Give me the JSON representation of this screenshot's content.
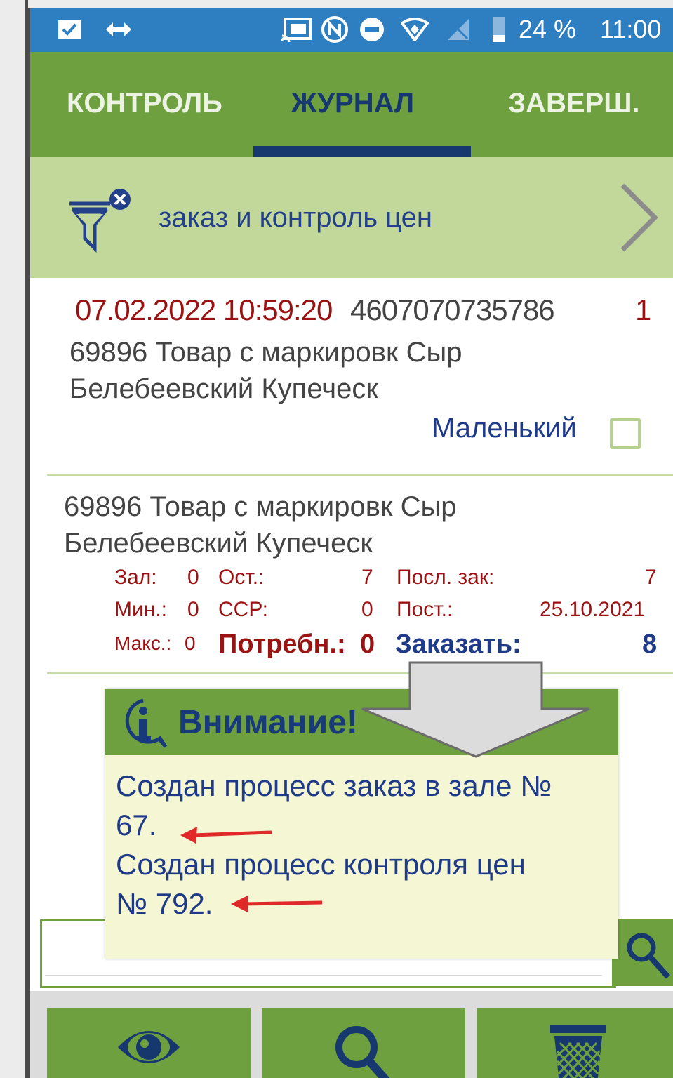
{
  "statusbar": {
    "battery": "24 %",
    "time": "11:00",
    "icons": [
      "checkbox-notification-icon",
      "code-icon",
      "cast-icon",
      "nfc-icon",
      "do-not-disturb-icon",
      "vpn-icon",
      "signal-off-icon",
      "battery-icon"
    ]
  },
  "tabs": [
    {
      "label": "КОНТРОЛЬ",
      "active": false
    },
    {
      "label": "ЖУРНАЛ",
      "active": true
    },
    {
      "label": "ЗАВЕРШ.",
      "active": false
    }
  ],
  "filter": {
    "label": "заказ и контроль цен",
    "icons": [
      "filter-clear-icon",
      "chevron-right-icon"
    ]
  },
  "item1": {
    "datetime": "07.02.2022 10:59:20",
    "barcode": "4607070735786",
    "count": "1",
    "title_line1": "69896   Товар с маркировк Сыр",
    "title_line2": "Белебеевский Купеческ",
    "size_label": "Маленький",
    "size_checked": false
  },
  "item2": {
    "title_line1": "69896   Товар с маркировк Сыр",
    "title_line2": "Белебеевский Купеческ",
    "zal_label": "Зал:",
    "zal_value": "0",
    "ost_label": "Ост.:",
    "ost_value": "7",
    "posl_zak_label": "Посл. зак:",
    "posl_zak_value": "7",
    "min_label": "Мин.:",
    "min_value": "0",
    "ssr_label": "ССР:",
    "ssr_value": "0",
    "post_label": "Пост.:",
    "post_value": "25.10.2021",
    "maks_label": "Макс.:",
    "maks_value": "0",
    "need_label": "Потребн.:",
    "need_value": "0",
    "order_label": "Заказать:",
    "order_value": "8"
  },
  "dialog": {
    "title": "Внимание!",
    "line1": "Создан процесс заказ в зале  №",
    "line2": "67.",
    "line3": "Создан процесс контроля цен",
    "line4": "№ 792."
  },
  "search": {
    "placeholder": ""
  },
  "bottombar": {
    "buttons": [
      "eye-icon",
      "search-icon",
      "trash-icon"
    ]
  },
  "colors": {
    "green": "#6ea03f",
    "light_green": "#c2d89a",
    "navy": "#16386e",
    "status_blue": "#2e7fc1",
    "dark_red": "#9a1212",
    "dialog_bg": "#f5f7d4"
  }
}
